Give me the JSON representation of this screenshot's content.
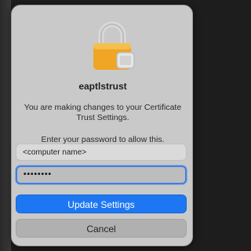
{
  "dialog": {
    "app_name": "eaptlstrust",
    "message": "You are making changes to your Certificate Trust Settings.",
    "prompt": "Enter your password to allow this.",
    "username_placeholder": "<computer name>",
    "password_mask": "••••••••",
    "primary_button": "Update Settings",
    "secondary_button": "Cancel"
  },
  "icons": {
    "lock": "lock-icon"
  },
  "colors": {
    "dialog_bg": "#c9c9c9",
    "primary": "#1e77f2",
    "focus_ring": "#3f7fe6",
    "lock_gold": "#f0a524"
  }
}
